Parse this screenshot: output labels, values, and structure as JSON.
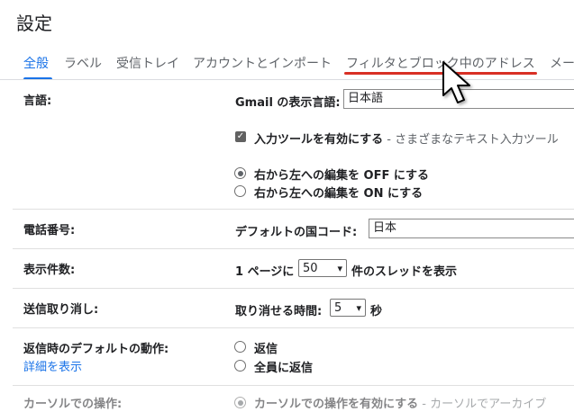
{
  "page": {
    "title": "設定"
  },
  "tabs": [
    {
      "label": "全般",
      "active": true
    },
    {
      "label": "ラベル"
    },
    {
      "label": "受信トレイ"
    },
    {
      "label": "アカウントとインポート"
    },
    {
      "label": "フィルタとブロック中のアドレス",
      "highlighted": true
    },
    {
      "label": "メー"
    }
  ],
  "colors": {
    "accent": "#1a73e8",
    "highlight_underline": "#d93025"
  },
  "rows": {
    "language": {
      "label": "言語:",
      "display_language_label": "Gmail の表示言語:",
      "display_language_value": "日本語",
      "input_tools_label": "入力ツールを有効にする",
      "input_tools_desc": " - さまざまなテキスト入力ツール",
      "input_tools_checked": true,
      "rtl_off": "右から左への編集を OFF にする",
      "rtl_on": "右から左への編集を ON にする",
      "rtl_selected": "off"
    },
    "phone": {
      "label": "電話番号:",
      "country_label": "デフォルトの国コード:",
      "country_value": "日本"
    },
    "page_size": {
      "label": "表示件数:",
      "prefix": "1 ページに",
      "value": "50",
      "suffix": "件のスレッドを表示"
    },
    "undo_send": {
      "label": "送信取り消し:",
      "prefix": "取り消せる時間:",
      "value": "5",
      "suffix": "秒"
    },
    "reply_default": {
      "label": "返信時のデフォルトの動作:",
      "details_link": "詳細を表示",
      "reply": "返信",
      "reply_all": "全員に返信",
      "selected": "none"
    },
    "cursor_ops": {
      "label": "カーソルでの操作:",
      "option": "カーソルでの操作を有効にする",
      "desc": " - カーソルでアーカイブ",
      "selected": true
    }
  }
}
